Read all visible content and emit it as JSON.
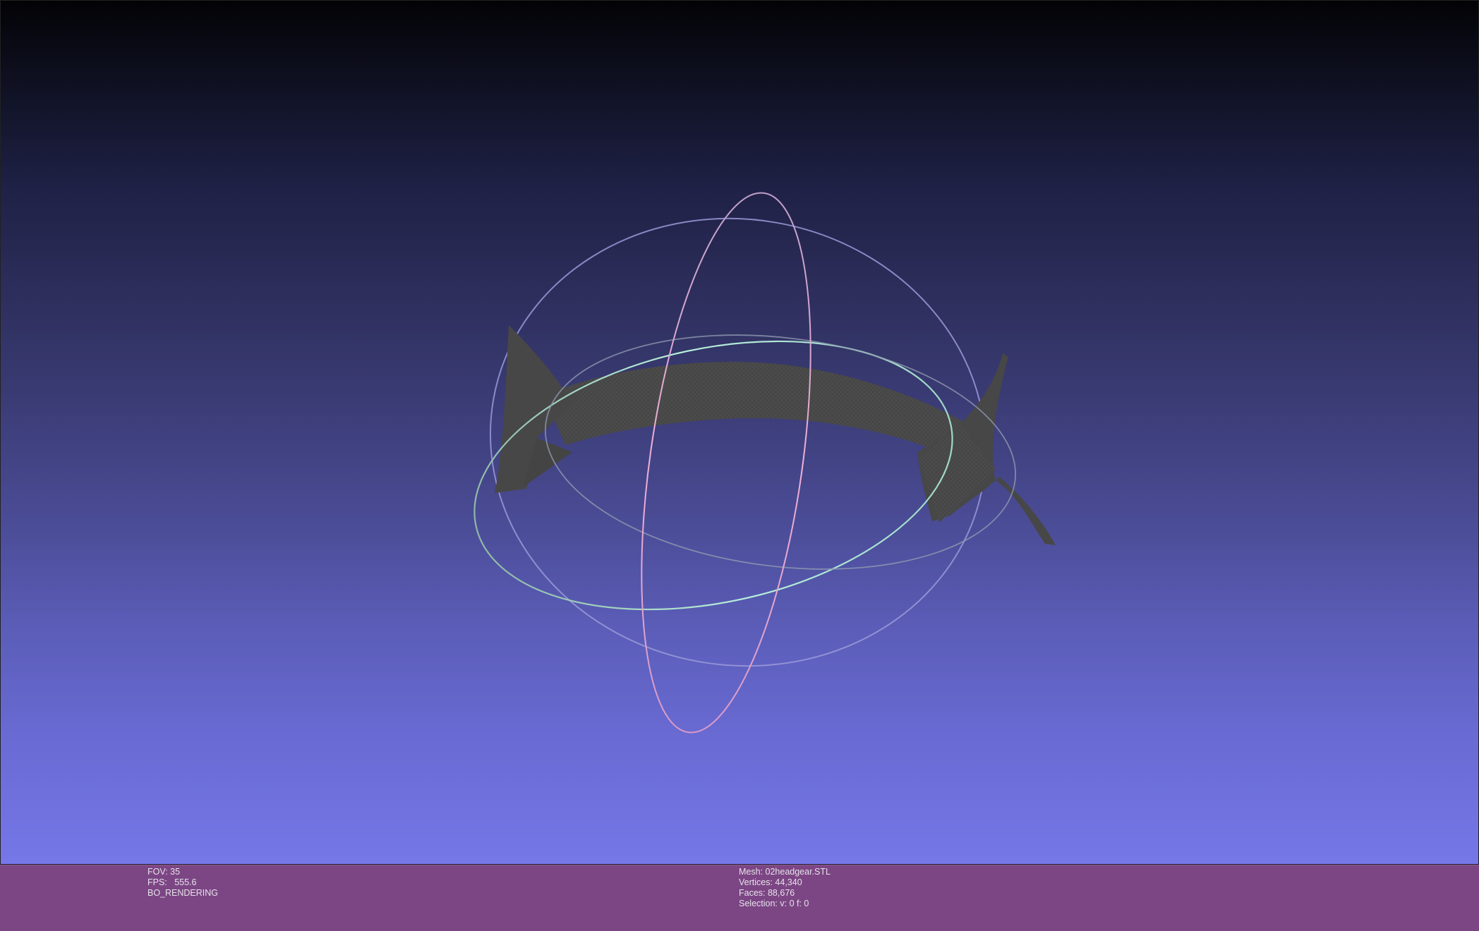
{
  "viewer": {
    "background": {
      "top_color": "#030306",
      "bottom_color": "#7677e8"
    },
    "mesh_color": "#474747",
    "trackball": {
      "ring_horizontal_color": "#9ee6c8",
      "ring_vertical_color": "#f0a6d4",
      "ring_frontal_color": "#b4b4f0"
    }
  },
  "info_bar": {
    "background": "#7c4684",
    "left": {
      "fov": "FOV: 35",
      "fps": "FPS:   555.6",
      "render_mode": "BO_RENDERING"
    },
    "right": {
      "mesh": "Mesh: 02headgear.STL",
      "vertices": "Vertices: 44,340",
      "faces": "Faces: 88,676",
      "selection": "Selection: v: 0 f: 0"
    }
  }
}
